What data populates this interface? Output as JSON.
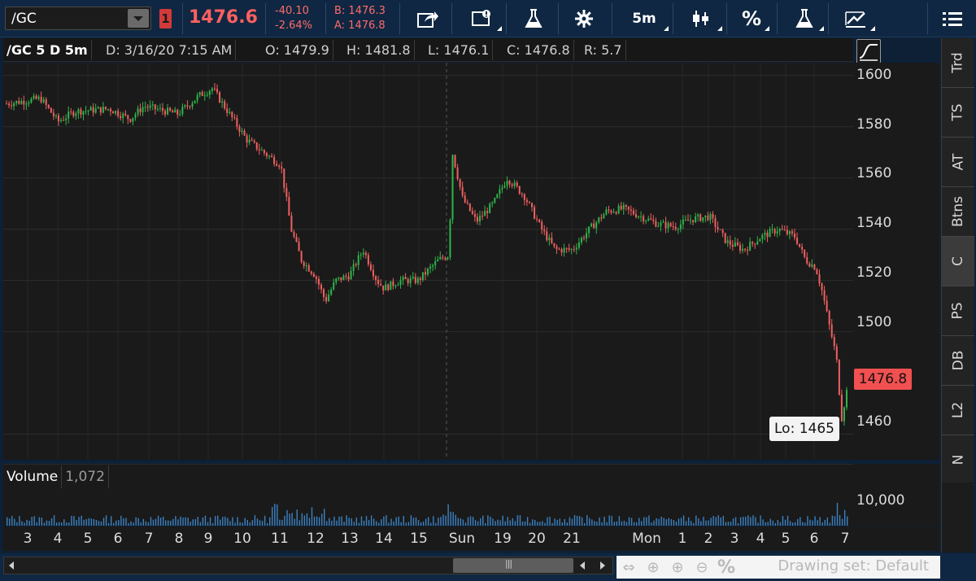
{
  "toolbar": {
    "symbol": "/GC",
    "link_badge": "1",
    "last_price": "1476.6",
    "net_change": "-40.10",
    "pct_change": "-2.64%",
    "bid": "B: 1476.3",
    "ask": "A: 1476.8",
    "timeframe": "5m",
    "percent": "%",
    "icons": [
      "share-icon",
      "message-icon",
      "flask-icon",
      "gear-icon",
      "candlestick-icon",
      "percent-icon",
      "flask-icon",
      "drawing-icon",
      "menu-icon"
    ]
  },
  "chart_header": {
    "title": "/GC 5 D 5m",
    "date": "D: 3/16/20 7:15 AM",
    "open": "O: 1479.9",
    "high": "H: 1481.8",
    "low": "L: 1476.1",
    "close": "C: 1476.8",
    "range": "R: 5.7"
  },
  "price_pane": {
    "last_tag": "1476.8",
    "low_bubble": "Lo: 1465",
    "ticks": [
      "1600",
      "1580",
      "1560",
      "1540",
      "1520",
      "1500",
      "1460"
    ]
  },
  "volume_pane": {
    "label": "Volume",
    "value": "1,072",
    "tick": "10,000"
  },
  "time_axis": {
    "labels": [
      "3",
      "4",
      "5",
      "6",
      "7",
      "8",
      "9",
      "10",
      "11",
      "12",
      "13",
      "14",
      "15",
      "Sun",
      "19",
      "20",
      "21",
      "Mon",
      "1",
      "2",
      "3",
      "4",
      "5",
      "6",
      "7"
    ]
  },
  "bottom_bar": {
    "drawing_set": "Drawing set: Default"
  },
  "side_panel": {
    "tabs": [
      "Trd",
      "TS",
      "AT",
      "Btns",
      "C",
      "PS",
      "DB",
      "L2",
      "N"
    ],
    "active": "C"
  },
  "colors": {
    "up": "#2fb54a",
    "down": "#f06060",
    "accent": "#ff6060",
    "background": "#1a1a1a",
    "volume": "#3a82c4"
  },
  "chart_data": {
    "type": "candlestick",
    "ylim": [
      1450,
      1605
    ],
    "y_ticks": [
      1600,
      1580,
      1560,
      1540,
      1520,
      1500,
      1460
    ],
    "volume_ticks": [
      10000
    ],
    "close_path": [
      [
        3,
        1589
      ],
      [
        4,
        1591
      ],
      [
        4.5,
        1582
      ],
      [
        5,
        1586
      ],
      [
        6,
        1587
      ],
      [
        6.6,
        1583
      ],
      [
        7,
        1588
      ],
      [
        8,
        1585
      ],
      [
        8.6,
        1592
      ],
      [
        9,
        1595
      ],
      [
        9.5,
        1585
      ],
      [
        10,
        1575
      ],
      [
        10.5,
        1570
      ],
      [
        11,
        1565
      ],
      [
        11.3,
        1540
      ],
      [
        11.6,
        1528
      ],
      [
        12,
        1522
      ],
      [
        12.3,
        1512
      ],
      [
        12.6,
        1520
      ],
      [
        13,
        1522
      ],
      [
        13.4,
        1532
      ],
      [
        13.8,
        1520
      ],
      [
        14,
        1517
      ],
      [
        14.5,
        1520
      ],
      [
        15,
        1520
      ],
      [
        15.6,
        1528
      ],
      [
        15.9,
        1530
      ],
      [
        16.0,
        1570
      ],
      [
        16.3,
        1552
      ],
      [
        16.7,
        1543
      ],
      [
        17.2,
        1550
      ],
      [
        17.6,
        1560
      ],
      [
        18.1,
        1553
      ],
      [
        18.6,
        1540
      ],
      [
        19,
        1532
      ],
      [
        19.5,
        1532
      ],
      [
        20,
        1540
      ],
      [
        20.5,
        1547
      ],
      [
        21,
        1548
      ],
      [
        21.5,
        1545
      ],
      [
        22,
        1542
      ],
      [
        22.5,
        1541
      ],
      [
        23,
        1544
      ],
      [
        23.5,
        1545
      ],
      [
        24,
        1535
      ],
      [
        24.5,
        1532
      ],
      [
        25,
        1537
      ],
      [
        25.5,
        1540
      ],
      [
        26,
        1537
      ],
      [
        26.3,
        1528
      ],
      [
        26.6,
        1525
      ],
      [
        26.8,
        1515
      ],
      [
        27,
        1502
      ],
      [
        27.2,
        1490
      ],
      [
        27.35,
        1466
      ],
      [
        27.5,
        1476.8
      ]
    ]
  }
}
